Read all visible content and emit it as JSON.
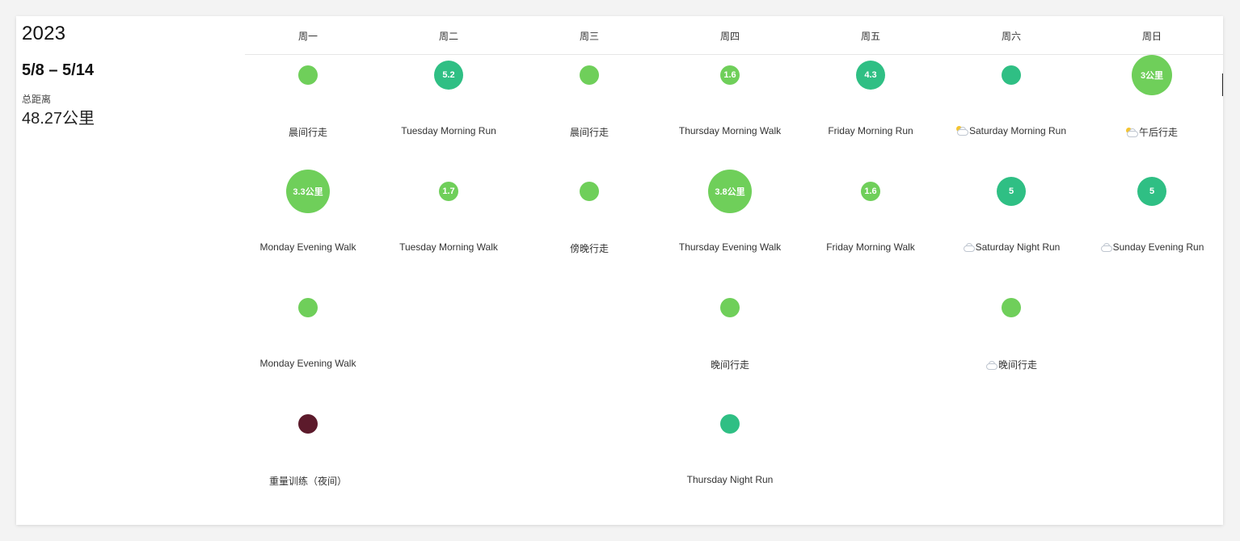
{
  "calendar": {
    "year": "2023",
    "range": "5/8 – 5/14",
    "total_label": "总距离",
    "total_value": "48.27公里"
  },
  "days": [
    "周一",
    "周二",
    "周三",
    "周四",
    "周五",
    "周六",
    "周日"
  ],
  "colors": {
    "walk": "#6fcf5a",
    "run": "#2fbf84",
    "strength": "#5c1a2b"
  },
  "activities": [
    {
      "day": 0,
      "row": 0,
      "label": "晨间行走",
      "bubble_text": "",
      "kind": "walk",
      "weather": ""
    },
    {
      "day": 0,
      "row": 1,
      "label": "Monday Evening Walk",
      "bubble_text": "3.3公里",
      "kind": "walk",
      "weather": ""
    },
    {
      "day": 0,
      "row": 2,
      "label": "Monday Evening Walk",
      "bubble_text": "",
      "kind": "walk",
      "weather": ""
    },
    {
      "day": 0,
      "row": 3,
      "label": "重量训练（夜间）",
      "bubble_text": "",
      "kind": "strength",
      "weather": ""
    },
    {
      "day": 1,
      "row": 0,
      "label": "Tuesday Morning Run",
      "bubble_text": "5.2",
      "kind": "run",
      "weather": ""
    },
    {
      "day": 1,
      "row": 1,
      "label": "Tuesday Morning Walk",
      "bubble_text": "1.7",
      "kind": "walk",
      "weather": ""
    },
    {
      "day": 2,
      "row": 0,
      "label": "晨间行走",
      "bubble_text": "",
      "kind": "walk",
      "weather": ""
    },
    {
      "day": 2,
      "row": 1,
      "label": "傍晚行走",
      "bubble_text": "",
      "kind": "walk",
      "weather": ""
    },
    {
      "day": 3,
      "row": 0,
      "label": "Thursday Morning Walk",
      "bubble_text": "1.6",
      "kind": "walk",
      "weather": ""
    },
    {
      "day": 3,
      "row": 1,
      "label": "Thursday Evening Walk",
      "bubble_text": "3.8公里",
      "kind": "walk",
      "weather": ""
    },
    {
      "day": 3,
      "row": 2,
      "label": "晚间行走",
      "bubble_text": "",
      "kind": "walk",
      "weather": ""
    },
    {
      "day": 3,
      "row": 3,
      "label": "Thursday Night Run",
      "bubble_text": "",
      "kind": "run",
      "weather": ""
    },
    {
      "day": 4,
      "row": 0,
      "label": "Friday Morning Run",
      "bubble_text": "4.3",
      "kind": "run",
      "weather": ""
    },
    {
      "day": 4,
      "row": 1,
      "label": "Friday Morning Walk",
      "bubble_text": "1.6",
      "kind": "walk",
      "weather": ""
    },
    {
      "day": 5,
      "row": 0,
      "label": "Saturday Morning Run",
      "bubble_text": "",
      "kind": "run",
      "weather": "partly-sunny"
    },
    {
      "day": 5,
      "row": 1,
      "label": "Saturday Night Run",
      "bubble_text": "5",
      "kind": "run",
      "weather": "cloudy"
    },
    {
      "day": 5,
      "row": 2,
      "label": "晚间行走",
      "bubble_text": "",
      "kind": "walk",
      "weather": "cloudy"
    },
    {
      "day": 6,
      "row": 0,
      "label": "午后行走",
      "bubble_text": "3公里",
      "kind": "walk",
      "weather": "partly-sunny"
    },
    {
      "day": 6,
      "row": 1,
      "label": "Sunday Evening Run",
      "bubble_text": "5",
      "kind": "run",
      "weather": "cloudy"
    }
  ]
}
